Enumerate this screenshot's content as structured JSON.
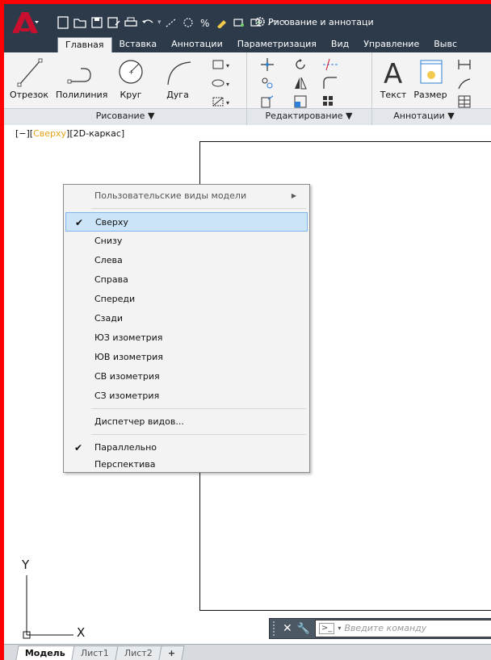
{
  "quick_access": {
    "icons": [
      "new-icon",
      "open-icon",
      "save-icon",
      "save-as-icon",
      "print-icon",
      "undo-icon",
      "redo-icon",
      "match-properties-icon",
      "share-icon"
    ],
    "workspace_label": "Рисование и аннотаци"
  },
  "ribbon_tabs": [
    "Главная",
    "Вставка",
    "Аннотации",
    "Параметризация",
    "Вид",
    "Управление",
    "Вывс"
  ],
  "ribbon": {
    "draw": {
      "tools": [
        "Отрезок",
        "Полилиния",
        "Круг",
        "Дуга"
      ],
      "panel_label": "Рисование ▼"
    },
    "modify": {
      "panel_label": "Редактирование ▼"
    },
    "annotation": {
      "tools": [
        "Текст",
        "Размер"
      ],
      "panel_label": "Аннотации ▼"
    }
  },
  "viewport": {
    "label_prefix": "[−][",
    "label_view": "Сверху",
    "label_mid": "][",
    "label_style": "2D-каркас",
    "label_suffix": "]"
  },
  "context_menu": {
    "submenu_item": "Пользовательские виды модели",
    "views": [
      "Сверху",
      "Снизу",
      "Слева",
      "Справа",
      "Спереди",
      "Сзади",
      "ЮЗ изометрия",
      "ЮВ изометрия",
      "СВ изометрия",
      "СЗ изометрия"
    ],
    "selected_view": "Сверху",
    "view_manager": "Диспетчер видов...",
    "projection": [
      "Параллельно",
      "Перспектива"
    ],
    "selected_projection": "Параллельно"
  },
  "ucs": {
    "x_label": "X",
    "y_label": "Y"
  },
  "command_line": {
    "placeholder": "Введите команду"
  },
  "layout_tabs": [
    "Модель",
    "Лист1",
    "Лист2",
    "+"
  ],
  "active_layout": "Модель",
  "colors": {
    "frame_border": "#ff0000",
    "title_bar": "#2d3a4a",
    "ribbon_bg": "#f3f3f3",
    "menu_highlight": "#cce4f7",
    "view_label_highlight": "#e8a317",
    "app_button": "#c8102e"
  }
}
